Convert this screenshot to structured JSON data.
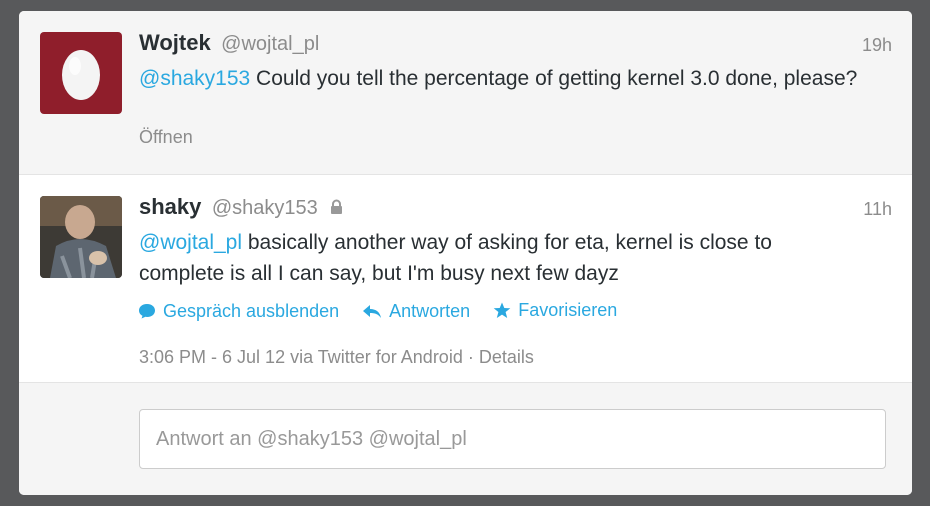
{
  "tweets": [
    {
      "name": "Wojtek",
      "handle": "@wojtal_pl",
      "time": "19h",
      "mention": "@shaky153",
      "text": " Could you tell the percentage of getting kernel 3.0 done, please?",
      "open_label": "Öffnen"
    },
    {
      "name": "shaky",
      "handle": "@shaky153",
      "time": "11h",
      "mention": "@wojtal_pl",
      "text": " basically another way of asking for eta, kernel is close to complete is all I can say, but I'm busy next few dayz",
      "actions": {
        "hide_conversation": "Gespräch ausblenden",
        "reply": "Antworten",
        "favorite": "Favorisieren"
      },
      "meta": {
        "timestamp": "3:06 PM - 6 Jul 12",
        "via": " via Twitter for Android",
        "separator": " · ",
        "details": "Details"
      }
    }
  ],
  "reply": {
    "placeholder": "Antwort an @shaky153 @wojtal_pl"
  },
  "colors": {
    "link": "#2aa8e0",
    "egg_background": "#8f1e2b"
  },
  "icons": [
    "egg-avatar-icon",
    "lock-icon",
    "speech-bubble-icon",
    "reply-arrow-icon",
    "star-icon"
  ]
}
